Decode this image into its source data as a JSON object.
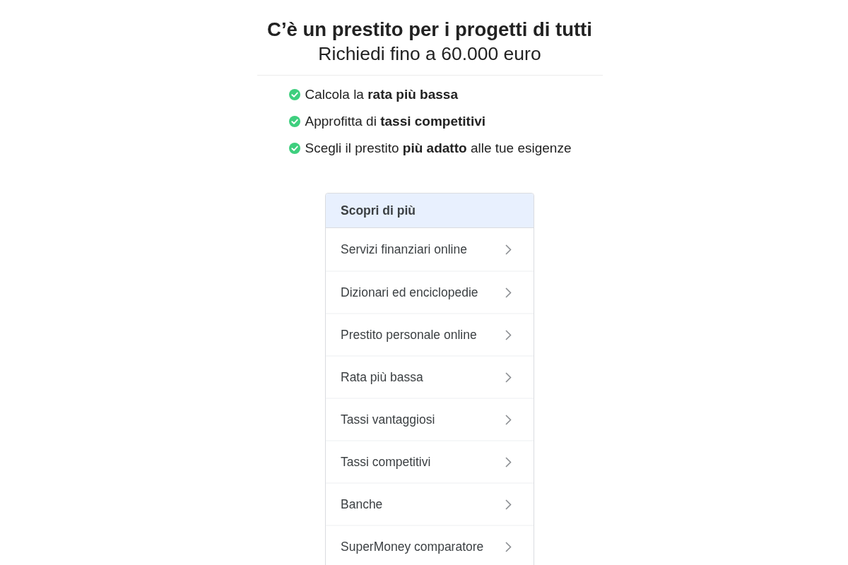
{
  "headline": {
    "title": "C’è un prestito per i progetti di tutti",
    "subtitle": "Richiedi fino a 60.000 euro"
  },
  "benefits": [
    "Calcola la **rata più bassa**",
    "Approfitta di **tassi competitivi**",
    "Scegli il prestito **più adatto** alle tue esigenze"
  ],
  "related_searches": {
    "title": "Scopri di più",
    "items": [
      "Servizi finanziari online",
      "Dizionari ed enciclopedie",
      "Prestito personale online",
      "Rata più bassa",
      "Tassi vantaggiosi",
      "Tassi competitivi",
      "Banche",
      "SuperMoney comparatore"
    ]
  }
}
